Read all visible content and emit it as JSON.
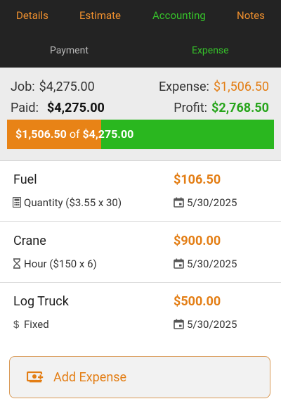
{
  "tabs": [
    "Details",
    "Estimate",
    "Accounting",
    "Notes"
  ],
  "subtabs": [
    "Payment",
    "Expense"
  ],
  "summary": {
    "job_label": "Job:",
    "job_value": "$4,275.00",
    "paid_label": "Paid:",
    "paid_value": "$4,275.00",
    "expense_label": "Expense:",
    "expense_value": "$1,506.50",
    "profit_label": "Profit:",
    "profit_value": "$2,768.50"
  },
  "progress": {
    "spent": "$1,506.50",
    "of_label": "of",
    "total": "$4,275.00",
    "fraction": 0.3524
  },
  "expenses": [
    {
      "name": "Fuel",
      "amount": "$106.50",
      "detail": "Quantity ($3.55 x 30)",
      "date": "5/30/2025",
      "type_icon": "calculator-icon"
    },
    {
      "name": "Crane",
      "amount": "$900.00",
      "detail": "Hour ($150 x 6)",
      "date": "5/30/2025",
      "type_icon": "hourglass-icon"
    },
    {
      "name": "Log Truck",
      "amount": "$500.00",
      "detail": "Fixed",
      "date": "5/30/2025",
      "type_icon": "dollar-icon"
    }
  ],
  "add_button_label": "Add Expense",
  "colors": {
    "accent_orange": "#e37e15",
    "accent_green": "#36c12a",
    "bar_green": "#2ab71f",
    "bar_orange": "#e88316",
    "topbar_bg": "#232323"
  }
}
